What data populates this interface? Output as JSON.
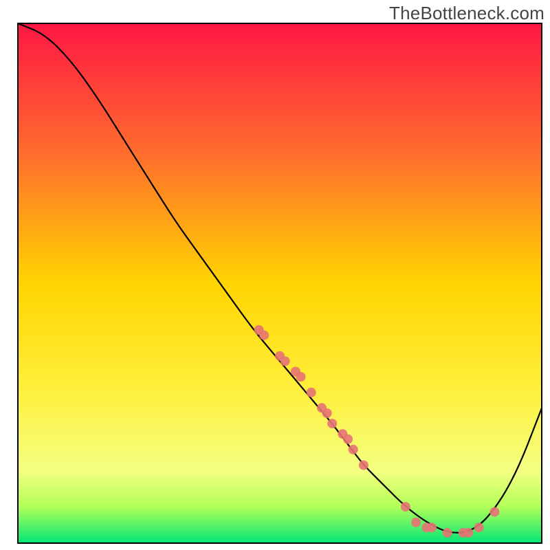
{
  "watermark": "TheBottleneck.com",
  "chart_data": {
    "type": "line",
    "title": "",
    "xlabel": "",
    "ylabel": "",
    "xlim": [
      0,
      100
    ],
    "ylim": [
      0,
      100
    ],
    "grid": false,
    "legend": false,
    "background_gradient": {
      "stops": [
        {
          "offset": 0.0,
          "color": "#ff1744"
        },
        {
          "offset": 0.25,
          "color": "#ff6d2d"
        },
        {
          "offset": 0.5,
          "color": "#ffd400"
        },
        {
          "offset": 0.7,
          "color": "#ffef3a"
        },
        {
          "offset": 0.86,
          "color": "#f4ff81"
        },
        {
          "offset": 0.93,
          "color": "#b2ff59"
        },
        {
          "offset": 1.0,
          "color": "#00e676"
        }
      ]
    },
    "series": [
      {
        "name": "bottleneck-curve",
        "color": "#000000",
        "x": [
          0,
          5,
          10,
          15,
          20,
          25,
          30,
          35,
          40,
          45,
          50,
          55,
          60,
          63,
          66,
          70,
          74,
          78,
          82,
          86,
          90,
          95,
          100
        ],
        "y": [
          100,
          98,
          93,
          86,
          78,
          70,
          62,
          55,
          48,
          41,
          35,
          29,
          23,
          19,
          15,
          11,
          7,
          4,
          2,
          2,
          5,
          13,
          26
        ]
      }
    ],
    "markers": {
      "name": "highlight-points",
      "color": "#e57373",
      "radius": 7,
      "points": [
        {
          "x": 46,
          "y": 41
        },
        {
          "x": 47,
          "y": 40
        },
        {
          "x": 50,
          "y": 36
        },
        {
          "x": 51,
          "y": 35
        },
        {
          "x": 53,
          "y": 33
        },
        {
          "x": 54,
          "y": 32
        },
        {
          "x": 56,
          "y": 29
        },
        {
          "x": 58,
          "y": 26
        },
        {
          "x": 59,
          "y": 25
        },
        {
          "x": 60,
          "y": 23
        },
        {
          "x": 62,
          "y": 21
        },
        {
          "x": 63,
          "y": 20
        },
        {
          "x": 64,
          "y": 18
        },
        {
          "x": 66,
          "y": 15
        },
        {
          "x": 74,
          "y": 7
        },
        {
          "x": 76,
          "y": 4
        },
        {
          "x": 78,
          "y": 3
        },
        {
          "x": 79,
          "y": 3
        },
        {
          "x": 82,
          "y": 2
        },
        {
          "x": 85,
          "y": 2
        },
        {
          "x": 86,
          "y": 2
        },
        {
          "x": 88,
          "y": 3
        },
        {
          "x": 91,
          "y": 6
        }
      ]
    }
  }
}
